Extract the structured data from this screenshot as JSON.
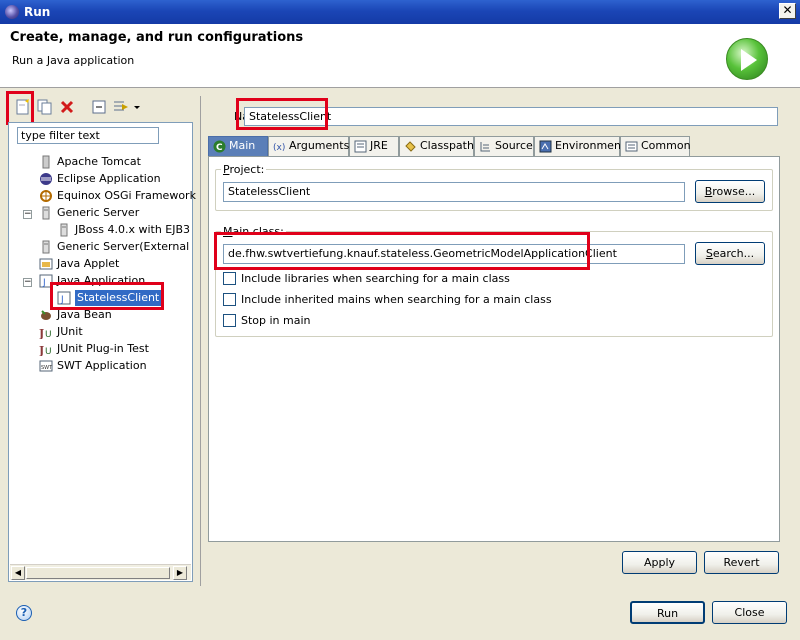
{
  "window": {
    "title": "Run",
    "close_glyph": "✕"
  },
  "header": {
    "title": "Create, manage, and run configurations",
    "subtitle": "Run a Java application",
    "banner_icon": "run-icon"
  },
  "left": {
    "filter_placeholder": "type filter text",
    "toolbar_icons": [
      "new-launch-config-icon",
      "duplicate-icon",
      "delete-icon",
      "collapse-all-icon",
      "filter-icon",
      "dropdown-arrow-icon"
    ],
    "tree": [
      {
        "label": "Apache Tomcat",
        "icon": "tomcat-icon"
      },
      {
        "label": "Eclipse Application",
        "icon": "eclipse-icon"
      },
      {
        "label": "Equinox OSGi Framework",
        "icon": "osgi-icon"
      },
      {
        "label": "Generic Server",
        "icon": "server-icon"
      },
      {
        "label": "JBoss 4.0.x with EJB3",
        "icon": "server-icon"
      },
      {
        "label": "Generic Server(External Launch)",
        "icon": "server-icon"
      },
      {
        "label": "Java Applet",
        "icon": "applet-icon"
      },
      {
        "label": "Java Application",
        "icon": "java-app-icon"
      },
      {
        "label": "StatelessClient",
        "icon": "java-app-icon"
      },
      {
        "label": "Java Bean",
        "icon": "bean-icon"
      },
      {
        "label": "JUnit",
        "icon": "junit-icon"
      },
      {
        "label": "JUnit Plug-in Test",
        "icon": "junit-plugin-icon"
      },
      {
        "label": "SWT Application",
        "icon": "swt-icon"
      }
    ]
  },
  "right": {
    "name_label": "Name:",
    "name_value": "StatelessClient",
    "tabs": [
      "Main",
      "Arguments",
      "JRE",
      "Classpath",
      "Source",
      "Environment",
      "Common"
    ],
    "project_label": "Project:",
    "project_value": "StatelessClient",
    "browse_label": "Browse...",
    "main_class_label": "Main class:",
    "main_class_value": "de.fhw.swtvertiefung.knauf.stateless.GeometricModelApplicationClient",
    "search_label": "Search...",
    "checkboxes": [
      "Include libraries when searching for a main class",
      "Include inherited mains when searching for a main class",
      "Stop in main"
    ],
    "apply_label": "Apply",
    "revert_label": "Revert"
  },
  "footer": {
    "help_glyph": "?",
    "run_label": "Run",
    "close_label": "Close"
  }
}
